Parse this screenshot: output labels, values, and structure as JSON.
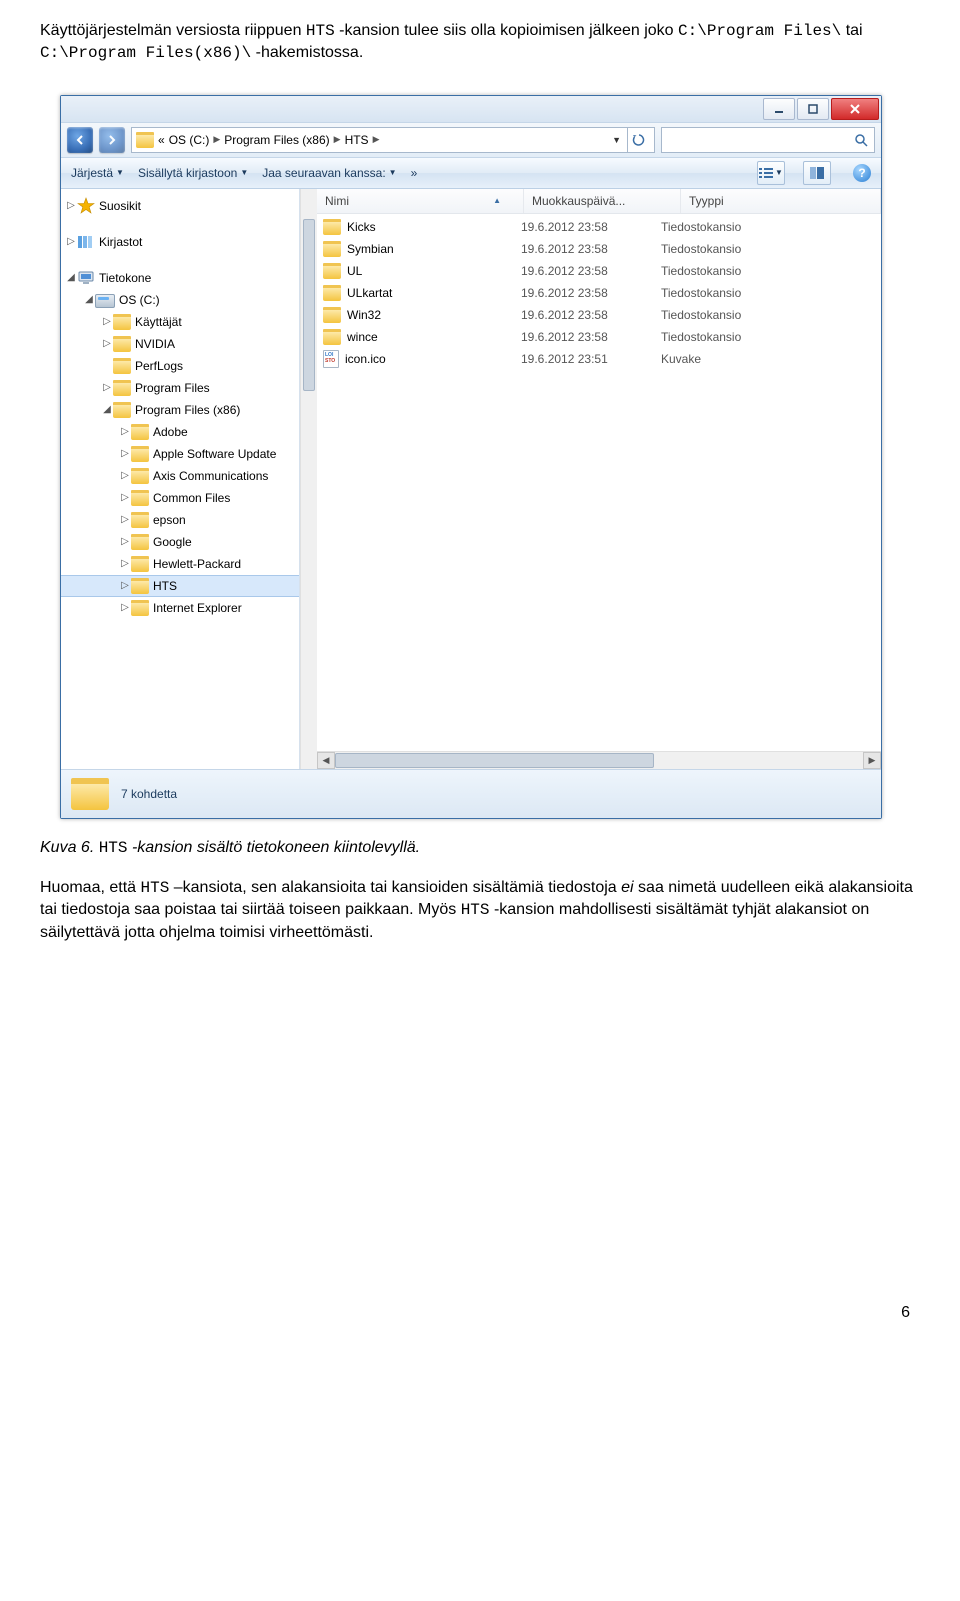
{
  "intro": {
    "part1": "Käyttöjärjestelmän versiosta riippuen ",
    "code1": "HTS",
    "part2": " -kansion tulee siis olla kopioimisen jälkeen joko ",
    "code2": "C:\\Program Files\\",
    "part3": " tai ",
    "code3": "C:\\Program Files(x86)\\",
    "part4": " -hakemistossa."
  },
  "caption": {
    "prefix": "Kuva 6. ",
    "code": "HTS",
    "suffix": " -kansion sisältö tietokoneen kiintolevyllä."
  },
  "note": {
    "p1": "Huomaa, että ",
    "c1": "HTS",
    "p2": " –kansiota, sen alakansioita tai kansioiden sisältämiä tiedostoja ",
    "ei": "ei",
    "p3": " saa nimetä uudelleen eikä alakansioita tai tiedostoja saa poistaa tai siirtää toiseen paikkaan. Myös ",
    "c2": "HTS",
    "p4": " -kansion mahdollisesti sisältämät tyhjät alakansiot on säilytettävä jotta ohjelma toimisi virheettömästi."
  },
  "pagenum": "6",
  "explorer": {
    "breadcrumb": {
      "laquo": "«",
      "items": [
        "OS (C:)",
        "Program Files (x86)",
        "HTS"
      ]
    },
    "toolbar": {
      "organize": "Järjestä",
      "include": "Sisällytä kirjastoon",
      "share": "Jaa seuraavan kanssa:",
      "more": "»"
    },
    "columns": {
      "name": "Nimi",
      "date": "Muokkauspäivä...",
      "type": "Tyyppi"
    },
    "tree": [
      {
        "indent": 0,
        "disclosure": "▷",
        "icon": "star",
        "label": "Suosikit"
      },
      {
        "indent": 0,
        "disclosure": "",
        "icon": "",
        "label": ""
      },
      {
        "indent": 0,
        "disclosure": "▷",
        "icon": "lib",
        "label": "Kirjastot"
      },
      {
        "indent": 0,
        "disclosure": "",
        "icon": "",
        "label": ""
      },
      {
        "indent": 0,
        "disclosure": "◢",
        "icon": "pc",
        "label": "Tietokone"
      },
      {
        "indent": 1,
        "disclosure": "◢",
        "icon": "drive",
        "label": "OS (C:)"
      },
      {
        "indent": 2,
        "disclosure": "▷",
        "icon": "folder",
        "label": "Käyttäjät"
      },
      {
        "indent": 2,
        "disclosure": "▷",
        "icon": "folder",
        "label": "NVIDIA"
      },
      {
        "indent": 2,
        "disclosure": "",
        "icon": "folder",
        "label": "PerfLogs"
      },
      {
        "indent": 2,
        "disclosure": "▷",
        "icon": "folder",
        "label": "Program Files"
      },
      {
        "indent": 2,
        "disclosure": "◢",
        "icon": "folder",
        "label": "Program Files (x86)"
      },
      {
        "indent": 3,
        "disclosure": "▷",
        "icon": "folder",
        "label": "Adobe"
      },
      {
        "indent": 3,
        "disclosure": "▷",
        "icon": "folder",
        "label": "Apple Software Update"
      },
      {
        "indent": 3,
        "disclosure": "▷",
        "icon": "folder",
        "label": "Axis Communications"
      },
      {
        "indent": 3,
        "disclosure": "▷",
        "icon": "folder",
        "label": "Common Files"
      },
      {
        "indent": 3,
        "disclosure": "▷",
        "icon": "folder",
        "label": "epson"
      },
      {
        "indent": 3,
        "disclosure": "▷",
        "icon": "folder",
        "label": "Google"
      },
      {
        "indent": 3,
        "disclosure": "▷",
        "icon": "folder",
        "label": "Hewlett-Packard"
      },
      {
        "indent": 3,
        "disclosure": "▷",
        "icon": "folder",
        "label": "HTS",
        "selected": true
      },
      {
        "indent": 3,
        "disclosure": "▷",
        "icon": "folder",
        "label": "Internet Explorer"
      }
    ],
    "files": [
      {
        "icon": "folder",
        "name": "Kicks",
        "date": "19.6.2012 23:58",
        "type": "Tiedostokansio"
      },
      {
        "icon": "folder",
        "name": "Symbian",
        "date": "19.6.2012 23:58",
        "type": "Tiedostokansio"
      },
      {
        "icon": "folder",
        "name": "UL",
        "date": "19.6.2012 23:58",
        "type": "Tiedostokansio"
      },
      {
        "icon": "folder",
        "name": "ULkartat",
        "date": "19.6.2012 23:58",
        "type": "Tiedostokansio"
      },
      {
        "icon": "folder",
        "name": "Win32",
        "date": "19.6.2012 23:58",
        "type": "Tiedostokansio"
      },
      {
        "icon": "folder",
        "name": "wince",
        "date": "19.6.2012 23:58",
        "type": "Tiedostokansio"
      },
      {
        "icon": "file",
        "name": "icon.ico",
        "date": "19.6.2012 23:51",
        "type": "Kuvake"
      }
    ],
    "status": "7 kohdetta"
  }
}
